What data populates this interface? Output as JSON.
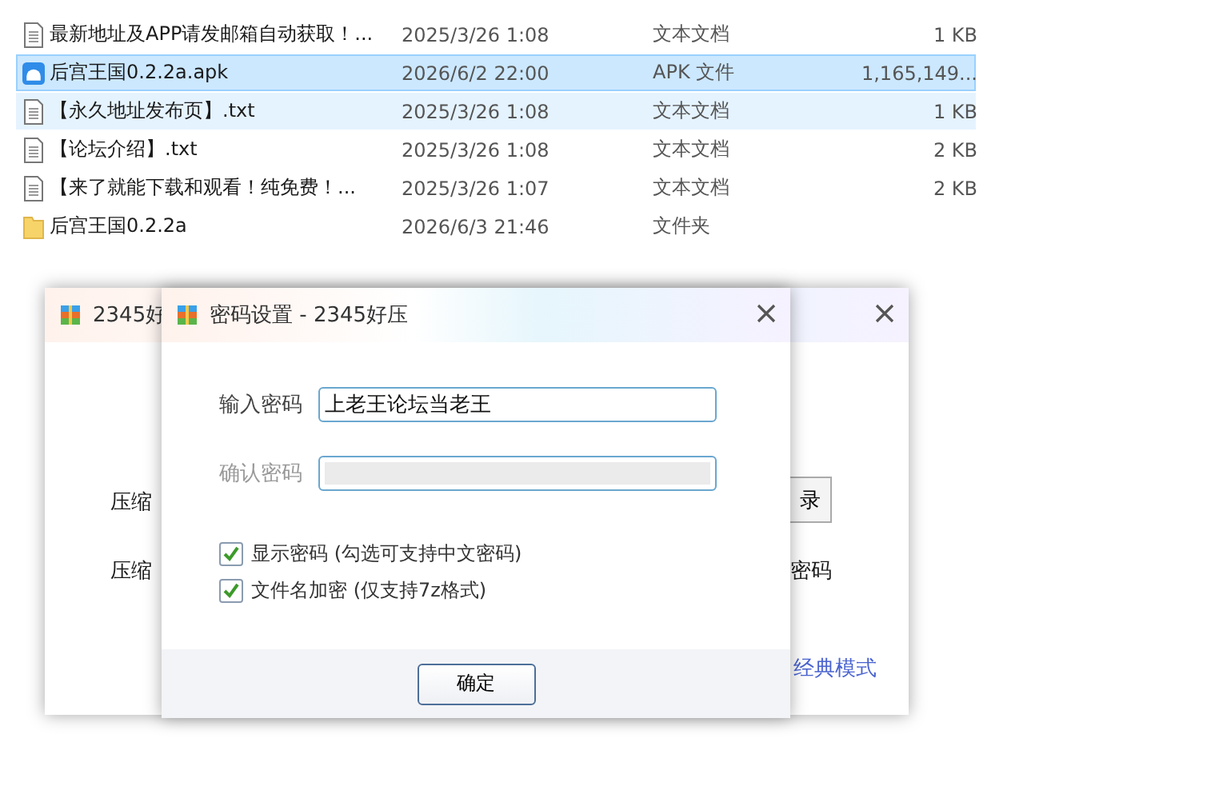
{
  "files": [
    {
      "kind": "text",
      "name": "最新地址及APP请发邮箱自动获取！...",
      "date": "2025/3/26 1:08",
      "type": "文本文档",
      "size": "1 KB",
      "selected": false,
      "hovered": false
    },
    {
      "kind": "apk",
      "name": "后宫王国0.2.2a.apk",
      "date": "2026/6/2 22:00",
      "type": "APK 文件",
      "size": "1,165,149...",
      "selected": true,
      "hovered": false
    },
    {
      "kind": "text",
      "name": "【永久地址发布页】.txt",
      "date": "2025/3/26 1:08",
      "type": "文本文档",
      "size": "1 KB",
      "selected": false,
      "hovered": true
    },
    {
      "kind": "text",
      "name": "【论坛介绍】.txt",
      "date": "2025/3/26 1:08",
      "type": "文本文档",
      "size": "2 KB",
      "selected": false,
      "hovered": false
    },
    {
      "kind": "text",
      "name": "【来了就能下载和观看！纯免费！...",
      "date": "2025/3/26 1:07",
      "type": "文本文档",
      "size": "2 KB",
      "selected": false,
      "hovered": false
    },
    {
      "kind": "folder",
      "name": "后宫王国0.2.2a",
      "date": "2026/6/3 21:46",
      "type": "文件夹",
      "selected": false,
      "hovered": false
    }
  ],
  "back_window": {
    "title": "2345好",
    "label_1": "压缩",
    "button": "录",
    "label_2": "压缩",
    "label_3": "密码",
    "link": "经典模式"
  },
  "dialog": {
    "title": "密码设置 - 2345好压",
    "fields": [
      {
        "label": "输入密码",
        "value": "上老王论坛当老王",
        "disabled": false
      },
      {
        "label": "确认密码",
        "disabled": true
      }
    ],
    "options": [
      {
        "label": "显示密码 (勾选可支持中文密码)",
        "checked": true
      },
      {
        "label": "文件名加密  (仅支持7z格式)",
        "checked": true
      }
    ],
    "ok_button": "确定"
  }
}
